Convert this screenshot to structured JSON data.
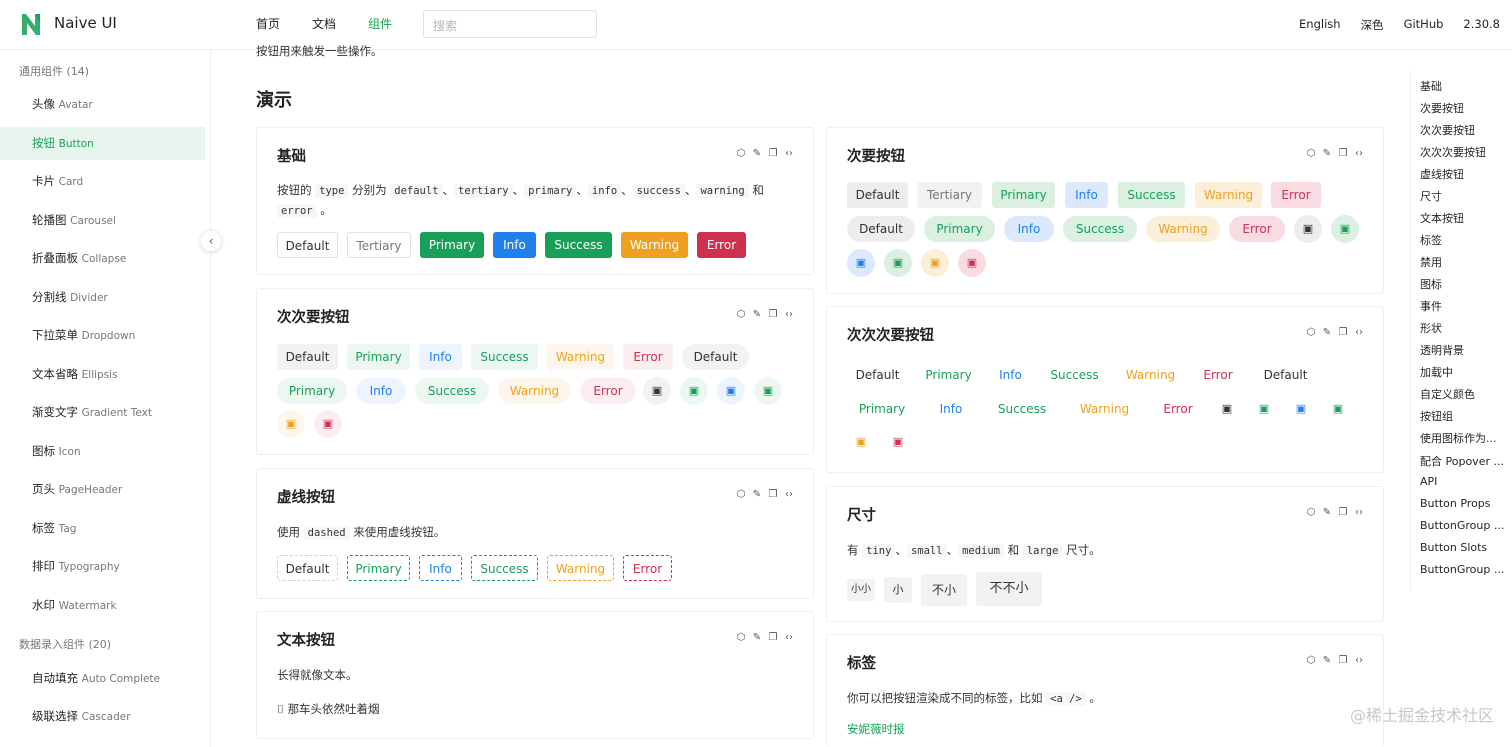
{
  "header": {
    "brand": "Naive UI",
    "nav": [
      "首页",
      "文档",
      "组件"
    ],
    "active_nav": "组件",
    "search_placeholder": "搜索",
    "right": [
      "English",
      "深色",
      "GitHub",
      "2.30.8"
    ],
    "accent": "#18a058"
  },
  "sidebar": {
    "group1": "通用组件 (14)",
    "group2": "数据录入组件 (20)",
    "items": [
      {
        "zh": "头像",
        "en": "Avatar"
      },
      {
        "zh": "按钮",
        "en": "Button"
      },
      {
        "zh": "卡片",
        "en": "Card"
      },
      {
        "zh": "轮播图",
        "en": "Carousel"
      },
      {
        "zh": "折叠面板",
        "en": "Collapse"
      },
      {
        "zh": "分割线",
        "en": "Divider"
      },
      {
        "zh": "下拉菜单",
        "en": "Dropdown"
      },
      {
        "zh": "文本省略",
        "en": "Ellipsis"
      },
      {
        "zh": "渐变文字",
        "en": "Gradient Text"
      },
      {
        "zh": "图标",
        "en": "Icon"
      },
      {
        "zh": "页头",
        "en": "PageHeader"
      },
      {
        "zh": "标签",
        "en": "Tag"
      },
      {
        "zh": "排印",
        "en": "Typography"
      },
      {
        "zh": "水印",
        "en": "Watermark"
      }
    ],
    "items2": [
      {
        "zh": "自动填充",
        "en": "Auto Complete"
      },
      {
        "zh": "级联选择",
        "en": "Cascader"
      }
    ],
    "active_index": 1
  },
  "main": {
    "intro": "按钮用来触发一些操作。",
    "demo_title": "演示",
    "labels": {
      "default": "Default",
      "tertiary": "Tertiary",
      "primary": "Primary",
      "info": "Info",
      "success": "Success",
      "warning": "Warning",
      "error": "Error"
    },
    "cards": {
      "basic": {
        "title": "基础",
        "desc_pre": "按钮的",
        "type": "type",
        "desc_mid": "分别为",
        "codes": [
          "default",
          "tertiary",
          "primary",
          "info",
          "success",
          "warning",
          "error"
        ],
        "sep": "、",
        "and": "和",
        "end": "。"
      },
      "secondary": {
        "title": "次要按钮"
      },
      "tertiary": {
        "title": "次次要按钮"
      },
      "quaternary": {
        "title": "次次次要按钮"
      },
      "dashed": {
        "title": "虚线按钮",
        "desc_pre": "使用",
        "code": "dashed",
        "desc_post": "来使用虚线按钮。"
      },
      "size": {
        "title": "尺寸",
        "desc_pre": "有",
        "codes": [
          "tiny",
          "small",
          "medium",
          "large"
        ],
        "sep": "、",
        "and": "和",
        "desc_post": "尺寸。",
        "buttons": [
          "小小",
          "小",
          "不小",
          "不不小"
        ]
      },
      "text": {
        "title": "文本按钮",
        "desc": "长得就像文本。",
        "button": "那车头依然吐着烟"
      },
      "tag": {
        "title": "标签",
        "desc_pre": "你可以把按钮渲染成不同的标签，比如",
        "code": "<a />",
        "desc_post": "。",
        "link": "安妮薇时报"
      }
    }
  },
  "anchor": [
    "基础",
    "次要按钮",
    "次次要按钮",
    "次次次要按钮",
    "虚线按钮",
    "尺寸",
    "文本按钮",
    "标签",
    "禁用",
    "图标",
    "事件",
    "形状",
    "透明背景",
    "加载中",
    "自定义颜色",
    "按钮组",
    "使用图标作为...",
    "配合 Popover ...",
    "API",
    "Button Props",
    "ButtonGroup ...",
    "Button Slots",
    "ButtonGroup ..."
  ],
  "watermark": "@稀土掘金技术社区",
  "colors": {
    "primary": "#18a058",
    "info": "#2080f0",
    "success": "#18a058",
    "warning": "#f0a020",
    "error": "#d03050"
  }
}
